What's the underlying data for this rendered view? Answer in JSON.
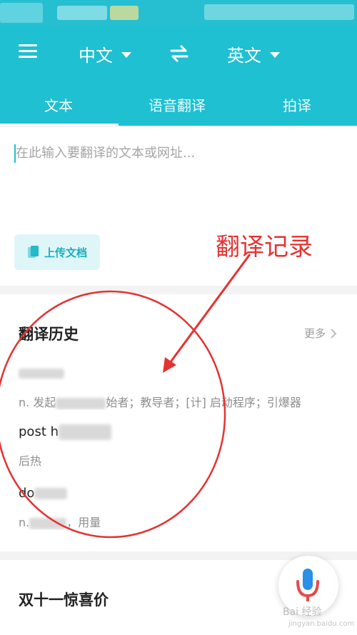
{
  "header": {
    "source_lang": "中文",
    "target_lang": "英文",
    "tabs": [
      {
        "label": "文本"
      },
      {
        "label": "语音翻译"
      },
      {
        "label": "拍译"
      }
    ]
  },
  "input": {
    "placeholder": "在此输入要翻译的文本或网址..."
  },
  "upload": {
    "label": "上传文档"
  },
  "annotation": {
    "text": "翻译记录"
  },
  "history": {
    "title": "翻译历史",
    "more_label": "更多",
    "items": [
      {
        "word": "",
        "def_pre": "n. 发起",
        "def_post": "始者；教导者；[计] 启动程序；引爆器"
      },
      {
        "word": "post h",
        "def_pre": "后热",
        "def_post": ""
      },
      {
        "word": "do",
        "def_pre": "n.",
        "def_post": "，用量"
      }
    ]
  },
  "promo": {
    "title": "双十一惊喜价"
  },
  "watermark": {
    "line1": "Bai  经验",
    "line2": "jingyan.baidu.com"
  },
  "colors": {
    "brand": "#1ec0d2",
    "annotation_red": "#e53232"
  },
  "icons": [
    "menu-icon",
    "swap-icon",
    "chevron-down-icon",
    "document-icon",
    "chevron-right-icon",
    "microphone-icon"
  ]
}
